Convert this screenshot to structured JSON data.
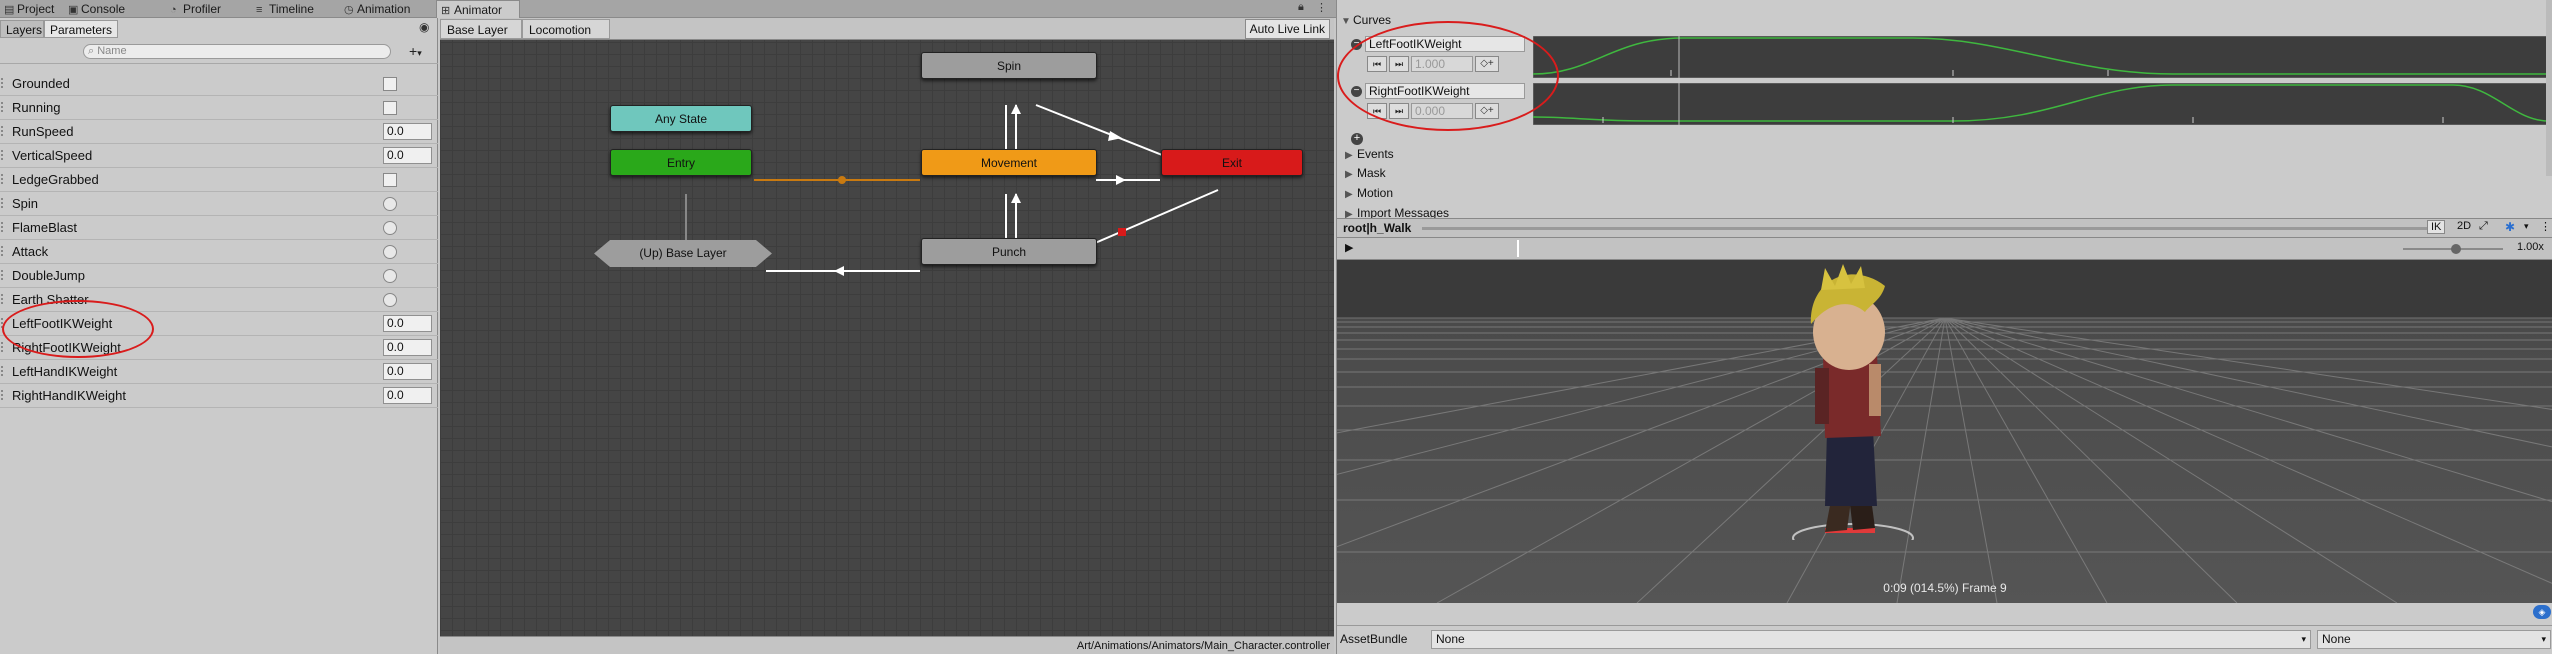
{
  "tabs": [
    {
      "label": "Project",
      "icon": "folder-icon"
    },
    {
      "label": "Console",
      "icon": "console-icon"
    },
    {
      "label": "Profiler",
      "icon": "profiler-icon"
    },
    {
      "label": "Timeline",
      "icon": "timeline-icon"
    },
    {
      "label": "Animation",
      "icon": "animation-icon"
    },
    {
      "label": "Animator",
      "icon": "animator-icon"
    }
  ],
  "left_panel": {
    "subtabs": [
      "Layers",
      "Parameters"
    ],
    "search_placeholder": "Name",
    "add_label": "+",
    "parameters": [
      {
        "name": "Grounded",
        "type": "bool"
      },
      {
        "name": "Running",
        "type": "bool"
      },
      {
        "name": "RunSpeed",
        "type": "float",
        "value": "0.0"
      },
      {
        "name": "VerticalSpeed",
        "type": "float",
        "value": "0.0"
      },
      {
        "name": "LedgeGrabbed",
        "type": "bool"
      },
      {
        "name": "Spin",
        "type": "trigger"
      },
      {
        "name": "FlameBlast",
        "type": "trigger"
      },
      {
        "name": "Attack",
        "type": "trigger"
      },
      {
        "name": "DoubleJump",
        "type": "trigger"
      },
      {
        "name": "Earth Shatter",
        "type": "trigger"
      },
      {
        "name": "LeftFootIKWeight",
        "type": "float",
        "value": "0.0"
      },
      {
        "name": "RightFootIKWeight",
        "type": "float",
        "value": "0.0"
      },
      {
        "name": "LeftHandIKWeight",
        "type": "float",
        "value": "0.0"
      },
      {
        "name": "RightHandIKWeight",
        "type": "float",
        "value": "0.0"
      }
    ]
  },
  "graph": {
    "breadcrumbs": [
      "Base Layer",
      "Locomotion"
    ],
    "auto_live_link": "Auto Live Link",
    "path": "Art/Animations/Animators/Main_Character.controller",
    "nodes": {
      "spin": "Spin",
      "any_state": "Any State",
      "entry": "Entry",
      "movement": "Movement",
      "exit": "Exit",
      "up_base": "(Up) Base Layer",
      "punch": "Punch"
    },
    "colors": {
      "any_state": "#6fc7bd",
      "entry": "#2aa81a",
      "movement": "#f09a17",
      "exit": "#d81a1a",
      "gray": "#9d9d9d"
    }
  },
  "inspector": {
    "curves_header": "Curves",
    "curves": [
      {
        "name": "LeftFootIKWeight",
        "value": "1.000"
      },
      {
        "name": "RightFootIKWeight",
        "value": "0.000"
      }
    ],
    "sections": [
      "Events",
      "Mask",
      "Motion",
      "Import Messages"
    ],
    "preview_title": "root|h_Walk",
    "ik_label": "IK",
    "twod_label": "2D",
    "speed": "1.00x",
    "time_readout": "0:09 (014.5%) Frame 9",
    "asset_bundle_label": "AssetBundle",
    "asset_bundle_value": "None",
    "asset_variant_value": "None"
  }
}
